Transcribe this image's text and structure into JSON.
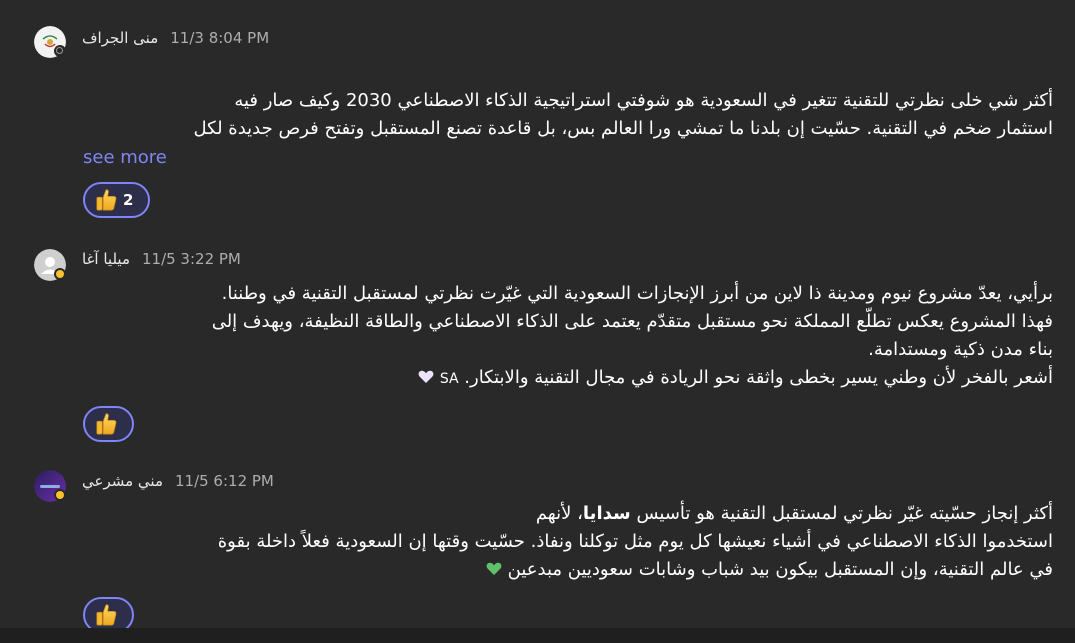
{
  "posts": [
    {
      "author": "منى الجراف",
      "time": "11/3 8:04 PM",
      "lines": [
        "أكثر شي خلى نظرتي للتقنية تتغير في السعودية هو شوفتي استراتيجية الذكاء الاصطناعي 2030 وكيف صار فيه",
        "استثمار ضخم في التقنية. حسّيت إن بلدنا ما تمشي ورا العالم بس، بل قاعدة تصنع المستقبل وتفتح فرص جديدة لكل"
      ],
      "see_more": "see more",
      "reaction": {
        "icon": "thumbs-up-icon",
        "count": "2"
      },
      "status_color": "#8a8a8a"
    },
    {
      "author": "ميليا آغا",
      "time": "11/5 3:22 PM",
      "lines": [
        "برأيي، يعدّ مشروع نيوم ومدينة ذا لاين من أبرز الإنجازات السعودية التي غيّرت نظرتي لمستقبل التقنية في وطننا.",
        "فهذا المشروع يعكس تطلّع المملكة نحو مستقبل متقدّم يعتمد على الذكاء الاصطناعي والطاقة النظيفة، ويهدف إلى",
        "بناء مدن ذكية ومستدامة.",
        "أشعر بالفخر لأن وطني يسير بخطى واثقة نحو الريادة في مجال التقنية والابتكار."
      ],
      "line4_suffix": "SA",
      "reaction": {
        "icon": "thumbs-up-icon"
      },
      "status_color": "#fcc12d"
    },
    {
      "author": "مني مشرعي",
      "time": "11/5 6:12 PM",
      "line1_pre": "أكثر إنجاز حسّيته غيّر نظرتي لمستقبل التقنية هو تأسيس",
      "line1_bold": "سدايا",
      "line1_post": "، لأنهم",
      "lines": [
        "استخدموا الذكاء الاصطناعي في أشياء نعيشها كل يوم مثل توكلنا ونفاذ. حسّيت وقتها إن السعودية فعلاً داخلة بقوة",
        "في عالم التقنية، وإن المستقبل بيكون بيد شباب وشابات سعوديين مبدعين"
      ],
      "reaction": {
        "icon": "thumbs-up-icon"
      },
      "status_color": "#fcc12d"
    }
  ],
  "colors": {
    "accent": "#7f85f5",
    "background": "#292929"
  }
}
